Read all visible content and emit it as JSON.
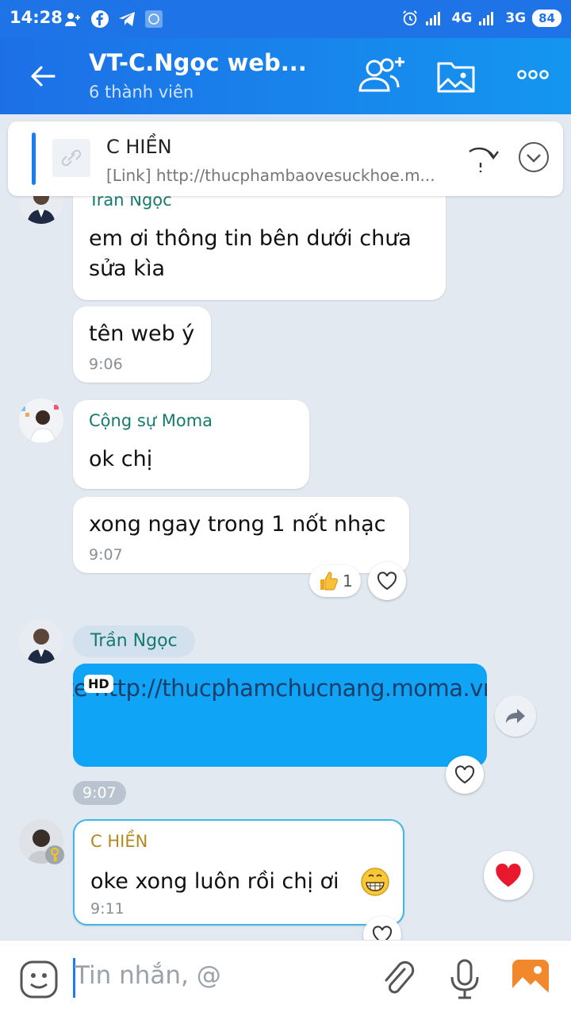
{
  "status_bar": {
    "time": "14:28",
    "network1": "4G",
    "network2": "3G",
    "battery": "84",
    "icons": [
      "add-friend-icon",
      "facebook-icon",
      "telegram-icon",
      "app-icon",
      "alarm-icon",
      "signal-icon"
    ]
  },
  "header": {
    "title": "VT-C.Ngọc web...",
    "subtitle": "6 thành viên",
    "icons": [
      "back-arrow-icon",
      "add-member-icon",
      "media-folder-icon",
      "more-icon"
    ]
  },
  "pinned": {
    "name": "C HIỀN",
    "link": "[Link] http://thucphambaovesuckhoe.m..."
  },
  "messages": {
    "m1": {
      "sender": "Trần Ngọc",
      "text_line1": "em ơi thông tin bên dưới chưa",
      "text_line2": "sửa kìa"
    },
    "m2": {
      "text": "tên web ý",
      "time": "9:06"
    },
    "m3": {
      "sender": "Cộng sự Moma",
      "text": "ok chị"
    },
    "m4": {
      "text": "xong ngay trong 1 nốt nhạc",
      "time": "9:07",
      "reaction_count": "1"
    },
    "m5": {
      "sender": "Trần Ngọc",
      "image_text": "te http://thucphamchucnang.moma.vn",
      "hd_label": "HD",
      "time": "9:07"
    },
    "m6": {
      "sender": "C HIỀN",
      "text": "oke xong luôn rồi chị ơi",
      "time": "9:11"
    }
  },
  "composer": {
    "placeholder": "Tin nhắn, @"
  },
  "colors": {
    "header": "#1e74e6",
    "accent": "#1a7cf5",
    "sender": "#157a6e",
    "image_bg": "#0fa4f5"
  }
}
